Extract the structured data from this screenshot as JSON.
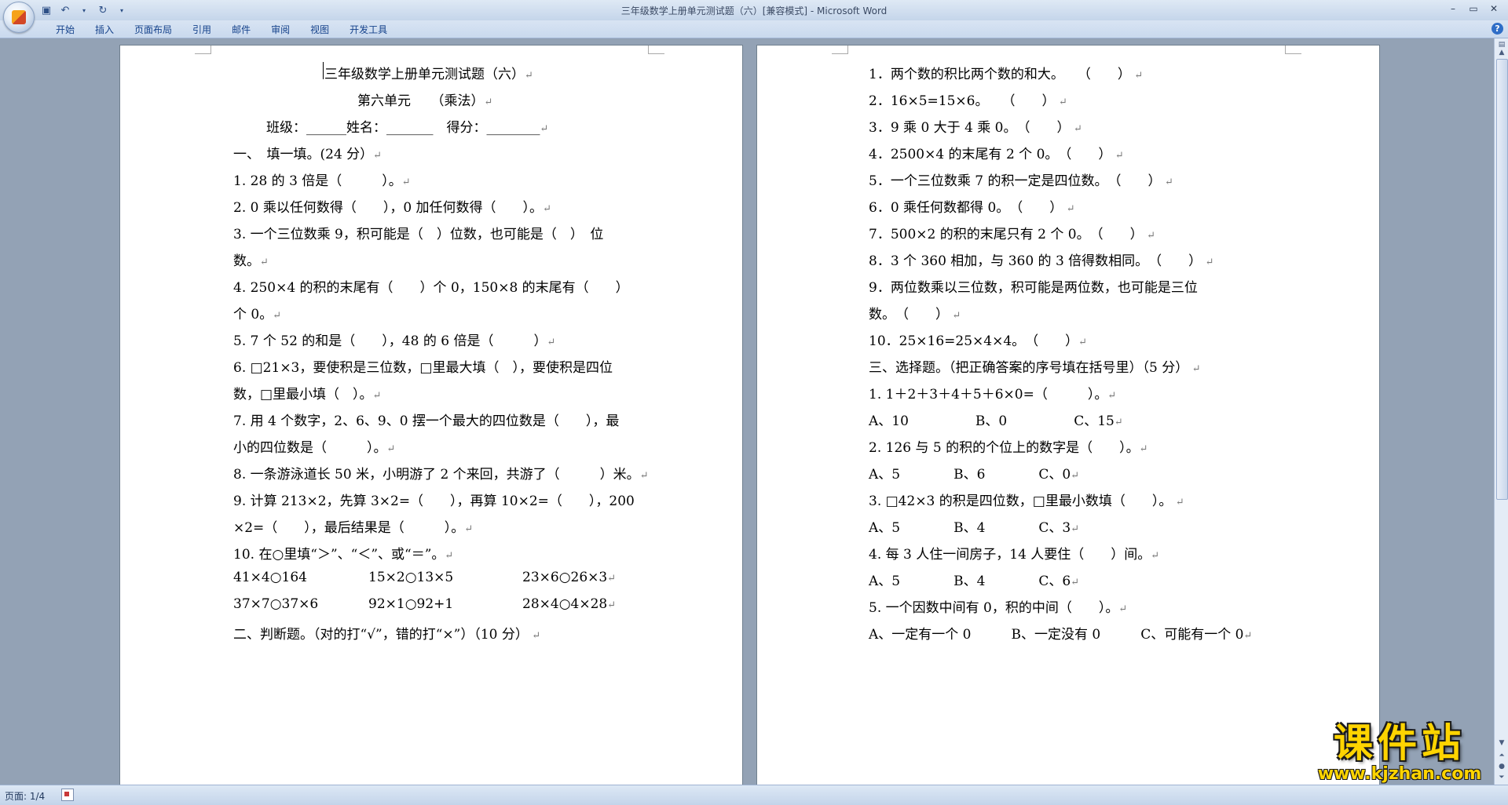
{
  "window": {
    "title": "三年级数学上册单元测试题（六）[兼容模式] - ",
    "app": "Microsoft Word"
  },
  "qat": [
    "save-icon",
    "undo-icon",
    "dropdown-icon",
    "redo-icon",
    "customize-icon"
  ],
  "ribbon_tabs": [
    "开始",
    "插入",
    "页面布局",
    "引用",
    "邮件",
    "审阅",
    "视图",
    "开发工具"
  ],
  "status": {
    "page": "页面: 1/4"
  },
  "watermark": {
    "main": "课件站",
    "sub": "www.kjzhan.com"
  },
  "left_page": {
    "title": "三年级数学上册单元测试题（六）",
    "subtitle": "第六单元　　（乘法）",
    "info": "班级：______姓名：_______　得分：________",
    "lines": [
      "一、　填一填。(24 分）",
      "1. 28 的 3 倍是（　　　）。",
      "2. 0 乘以任何数得（　　），0 加任何数得（　　）。",
      "3. 一个三位数乘 9，积可能是（　）位数，也可能是（　）　位",
      "数。",
      "4. 250×4 的积的末尾有（　　）个 0，150×8 的末尾有（　　）",
      "个 0。",
      "5. 7 个 52 的和是（　　），48 的 6 倍是（　　　）",
      "6. □21×3，要使积是三位数，□里最大填（　），要使积是四位",
      "数，□里最小填（　）。",
      "7. 用 4 个数字，2、6、9、0 摆一个最大的四位数是（　　），最",
      "小的四位数是（　　　）。",
      "8. 一条游泳道长 50 米，小明游了 2 个来回，共游了（　　　）米。",
      "9. 计算 213×2，先算 3×2=（　　），再算 10×2=（　　），200",
      "×2=（　　），最后结果是（　　　）。",
      "10. 在○里填“＞”、“＜”、或“＝”。"
    ],
    "compare_row1": [
      "41×4○164",
      "15×2○13×5",
      "23×6○26×3"
    ],
    "compare_row2": [
      "37×7○37×6",
      "92×1○92+1",
      "28×4○4×28"
    ],
    "section2": "二、判断题。（对的打“√”，错的打“×”）（10 分）"
  },
  "right_page": {
    "lines": [
      "1．两个数的积比两个数的和大。　　（　　）",
      "2．16×5=15×6。　　（　　）",
      "3．9 乘 0 大于 4 乘 0。　（　　）",
      "4．2500×4 的末尾有 2 个 0。　（　　）",
      "5．一个三位数乘 7 的积一定是四位数。　（　　）",
      "6．0 乘任何数都得 0。　（　　）",
      "7．500×2 的积的末尾只有 2 个 0。　（　　）",
      "8．3 个 360 相加，与 360 的 3 倍得数相同。　（　　）",
      "9．两位数乘以三位数，积可能是两位数，也可能是三位",
      "数。　（　　）",
      "10．25×16=25×4×4。　（　　）",
      "三、选择题。（把正确答案的序号填在括号里）（5 分）",
      "1. 1＋2＋3＋4＋5＋6×0=（　　　）。",
      "A、10　　　　　B、0　　　　　C、15",
      "2. 126 与 5 的积的个位上的数字是（　　）。",
      "A、5　　　　B、6　　　　C、0",
      "3. □42×3 的积是四位数，□里最小数填（　　）。",
      "A、5　　　　B、4　　　　C、3",
      "4. 每 3 人住一间房子，14 人要住（　　）间。",
      "A、5　　　　B、4　　　　C、6",
      "5. 一个因数中间有 0，积的中间（　　）。",
      "A、一定有一个 0　　　B、一定没有 0　　　C、可能有一个 0"
    ]
  }
}
